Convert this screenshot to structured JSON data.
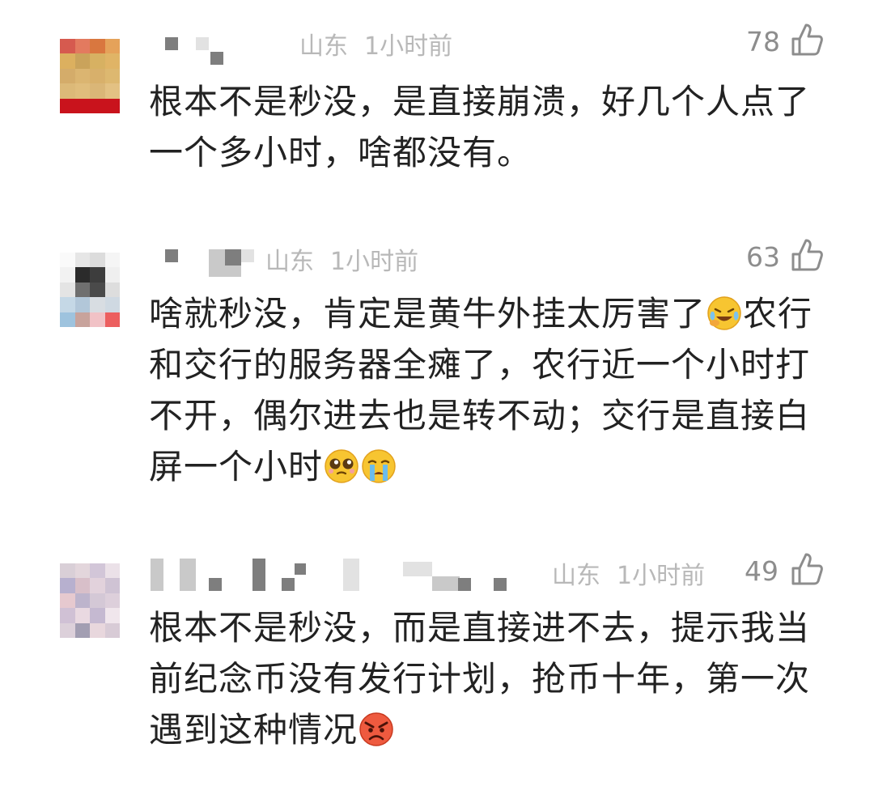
{
  "comments": [
    {
      "location": "山东",
      "time": "1小时前",
      "likes": "78",
      "text": "根本不是秒没，是直接崩溃，好几个人点了一个多小时，啥都没有。"
    },
    {
      "location": "山东",
      "time": "1小时前",
      "likes": "63",
      "text_1": "啥就秒没，肯定是黄牛外挂太厉害了",
      "text_2": "农行和交行的服务器全瘫了，农行近一个小时打不开，偶尔进去也是转不动；交行是直接白屏一个小时",
      "emoji_1": "crying-laughing-emoji",
      "emoji_2": "pleading-emoji",
      "emoji_3": "crying-emoji"
    },
    {
      "location": "山东",
      "time": "1小时前",
      "likes": "49",
      "text": "根本不是秒没，而是直接进不去，提示我当前纪念币没有发行计划，抢币十年，第一次遇到这种情况",
      "emoji": "angry-emoji"
    }
  ],
  "colors": {
    "text": "#222222",
    "meta": "#b8b8b8",
    "like_count": "#8d8d8d"
  }
}
